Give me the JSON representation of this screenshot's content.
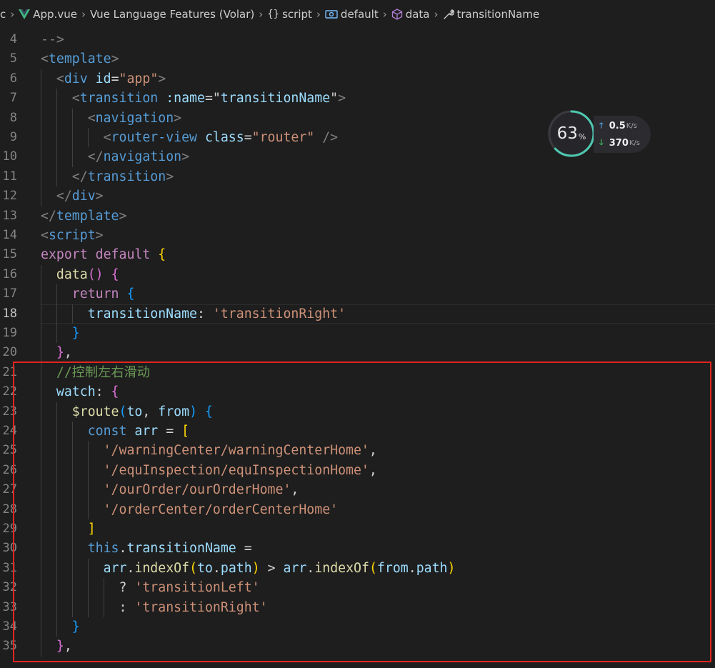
{
  "breadcrumb": {
    "lead": "c",
    "items": [
      {
        "icon": "vue-logo-icon",
        "label": "App.vue"
      },
      {
        "icon": "",
        "label": "Vue Language Features (Volar)"
      },
      {
        "icon": "braces-icon",
        "label": "script"
      },
      {
        "icon": "object-icon",
        "label": "default"
      },
      {
        "icon": "cube-icon",
        "label": "data"
      },
      {
        "icon": "wrench-icon",
        "label": "transitionName"
      }
    ]
  },
  "editor": {
    "current_line": "18",
    "lines": [
      {
        "num": "4",
        "tokens": [
          [
            "-->",
            "punc"
          ]
        ]
      },
      {
        "num": "5",
        "tokens": [
          [
            "<",
            "punc"
          ],
          [
            "template",
            "tag"
          ],
          [
            ">",
            "punc"
          ]
        ]
      },
      {
        "num": "6",
        "tokens": [
          [
            "<",
            "punc"
          ],
          [
            "div",
            "tag"
          ],
          [
            " ",
            "tx"
          ],
          [
            "id",
            "attr"
          ],
          [
            "=",
            "tx"
          ],
          [
            "\"app\"",
            "str"
          ],
          [
            ">",
            "punc"
          ]
        ]
      },
      {
        "num": "7",
        "tokens": [
          [
            "<",
            "punc"
          ],
          [
            "transition",
            "tag"
          ],
          [
            " ",
            "tx"
          ],
          [
            ":name",
            "attr"
          ],
          [
            "=",
            "tx"
          ],
          [
            "\"",
            "tx"
          ],
          [
            "transitionName",
            "var"
          ],
          [
            "\"",
            "tx"
          ],
          [
            ">",
            "punc"
          ]
        ]
      },
      {
        "num": "8",
        "tokens": [
          [
            "<",
            "punc"
          ],
          [
            "navigation",
            "tag"
          ],
          [
            ">",
            "punc"
          ]
        ]
      },
      {
        "num": "9",
        "tokens": [
          [
            "<",
            "punc"
          ],
          [
            "router-view",
            "tag"
          ],
          [
            " ",
            "tx"
          ],
          [
            "class",
            "attr"
          ],
          [
            "=",
            "tx"
          ],
          [
            "\"router\"",
            "str"
          ],
          [
            " />",
            "punc"
          ]
        ]
      },
      {
        "num": "10",
        "tokens": [
          [
            "</",
            "punc"
          ],
          [
            "navigation",
            "tag"
          ],
          [
            ">",
            "punc"
          ]
        ]
      },
      {
        "num": "11",
        "tokens": [
          [
            "</",
            "punc"
          ],
          [
            "transition",
            "tag"
          ],
          [
            ">",
            "punc"
          ]
        ]
      },
      {
        "num": "12",
        "tokens": [
          [
            "</",
            "punc"
          ],
          [
            "div",
            "tag"
          ],
          [
            ">",
            "punc"
          ]
        ]
      },
      {
        "num": "13",
        "tokens": [
          [
            "</",
            "punc"
          ],
          [
            "template",
            "tag"
          ],
          [
            ">",
            "punc"
          ]
        ]
      },
      {
        "num": "14",
        "tokens": [
          [
            "<",
            "punc"
          ],
          [
            "script",
            "tag"
          ],
          [
            ">",
            "punc"
          ]
        ]
      },
      {
        "num": "15",
        "tokens": [
          [
            "export",
            "ctl"
          ],
          [
            " ",
            "tx"
          ],
          [
            "default",
            "ctl"
          ],
          [
            " ",
            "tx"
          ],
          [
            "{",
            "b1"
          ]
        ]
      },
      {
        "num": "16",
        "tokens": [
          [
            "data",
            "fn"
          ],
          [
            "()",
            "b2"
          ],
          [
            " ",
            "tx"
          ],
          [
            "{",
            "b2"
          ]
        ]
      },
      {
        "num": "17",
        "tokens": [
          [
            "return",
            "ctl"
          ],
          [
            " ",
            "tx"
          ],
          [
            "{",
            "b3"
          ]
        ]
      },
      {
        "num": "18",
        "tokens": [
          [
            "transitionName",
            "var"
          ],
          [
            ": ",
            "tx"
          ],
          [
            "'transitionRight'",
            "str"
          ]
        ]
      },
      {
        "num": "19",
        "tokens": [
          [
            "}",
            "b3"
          ]
        ]
      },
      {
        "num": "20",
        "tokens": [
          [
            "}",
            "b2"
          ],
          [
            ",",
            "tx"
          ]
        ]
      },
      {
        "num": "21",
        "tokens": [
          [
            "//控制左右滑动",
            "cmt"
          ]
        ]
      },
      {
        "num": "22",
        "tokens": [
          [
            "watch",
            "var"
          ],
          [
            ": ",
            "tx"
          ],
          [
            "{",
            "b2"
          ]
        ]
      },
      {
        "num": "23",
        "tokens": [
          [
            "$route",
            "fn"
          ],
          [
            "(",
            "b3"
          ],
          [
            "to",
            "var"
          ],
          [
            ", ",
            "tx"
          ],
          [
            "from",
            "var"
          ],
          [
            ")",
            "b3"
          ],
          [
            " ",
            "tx"
          ],
          [
            "{",
            "b3"
          ]
        ]
      },
      {
        "num": "24",
        "tokens": [
          [
            "const",
            "kw"
          ],
          [
            " ",
            "tx"
          ],
          [
            "arr",
            "var"
          ],
          [
            " = ",
            "tx"
          ],
          [
            "[",
            "b1"
          ]
        ]
      },
      {
        "num": "25",
        "tokens": [
          [
            "'/warningCenter/warningCenterHome'",
            "str"
          ],
          [
            ",",
            "tx"
          ]
        ]
      },
      {
        "num": "26",
        "tokens": [
          [
            "'/equInspection/equInspectionHome'",
            "str"
          ],
          [
            ",",
            "tx"
          ]
        ]
      },
      {
        "num": "27",
        "tokens": [
          [
            "'/ourOrder/ourOrderHome'",
            "str"
          ],
          [
            ",",
            "tx"
          ]
        ]
      },
      {
        "num": "28",
        "tokens": [
          [
            "'/orderCenter/orderCenterHome'",
            "str"
          ]
        ]
      },
      {
        "num": "29",
        "tokens": [
          [
            "]",
            "b1"
          ]
        ]
      },
      {
        "num": "30",
        "tokens": [
          [
            "this",
            "kw"
          ],
          [
            ".",
            "tx"
          ],
          [
            "transitionName",
            "var"
          ],
          [
            " =",
            "tx"
          ]
        ]
      },
      {
        "num": "31",
        "tokens": [
          [
            "arr",
            "var"
          ],
          [
            ".",
            "tx"
          ],
          [
            "indexOf",
            "fn"
          ],
          [
            "(",
            "b1"
          ],
          [
            "to",
            "var"
          ],
          [
            ".",
            "tx"
          ],
          [
            "path",
            "var"
          ],
          [
            ")",
            "b1"
          ],
          [
            " > ",
            "tx"
          ],
          [
            "arr",
            "var"
          ],
          [
            ".",
            "tx"
          ],
          [
            "indexOf",
            "fn"
          ],
          [
            "(",
            "b1"
          ],
          [
            "from",
            "var"
          ],
          [
            ".",
            "tx"
          ],
          [
            "path",
            "var"
          ],
          [
            ")",
            "b1"
          ]
        ]
      },
      {
        "num": "32",
        "tokens": [
          [
            "? ",
            "tx"
          ],
          [
            "'transitionLeft'",
            "str"
          ]
        ]
      },
      {
        "num": "33",
        "tokens": [
          [
            ": ",
            "tx"
          ],
          [
            "'transitionRight'",
            "str"
          ]
        ]
      },
      {
        "num": "34",
        "tokens": [
          [
            "}",
            "b3"
          ]
        ]
      },
      {
        "num": "35",
        "tokens": [
          [
            "}",
            "b2"
          ],
          [
            ",",
            "tx"
          ]
        ]
      }
    ]
  },
  "network_widget": {
    "cpu_percent": "63",
    "percent_sign": "%",
    "upload": "0.5",
    "download": "370",
    "unit": "K/s",
    "arc_color": "#4ec9b0",
    "arc_color_end": "#e6c84a"
  },
  "colors": {
    "highlight_box": "#e3251d",
    "background": "#1e1e1e"
  }
}
